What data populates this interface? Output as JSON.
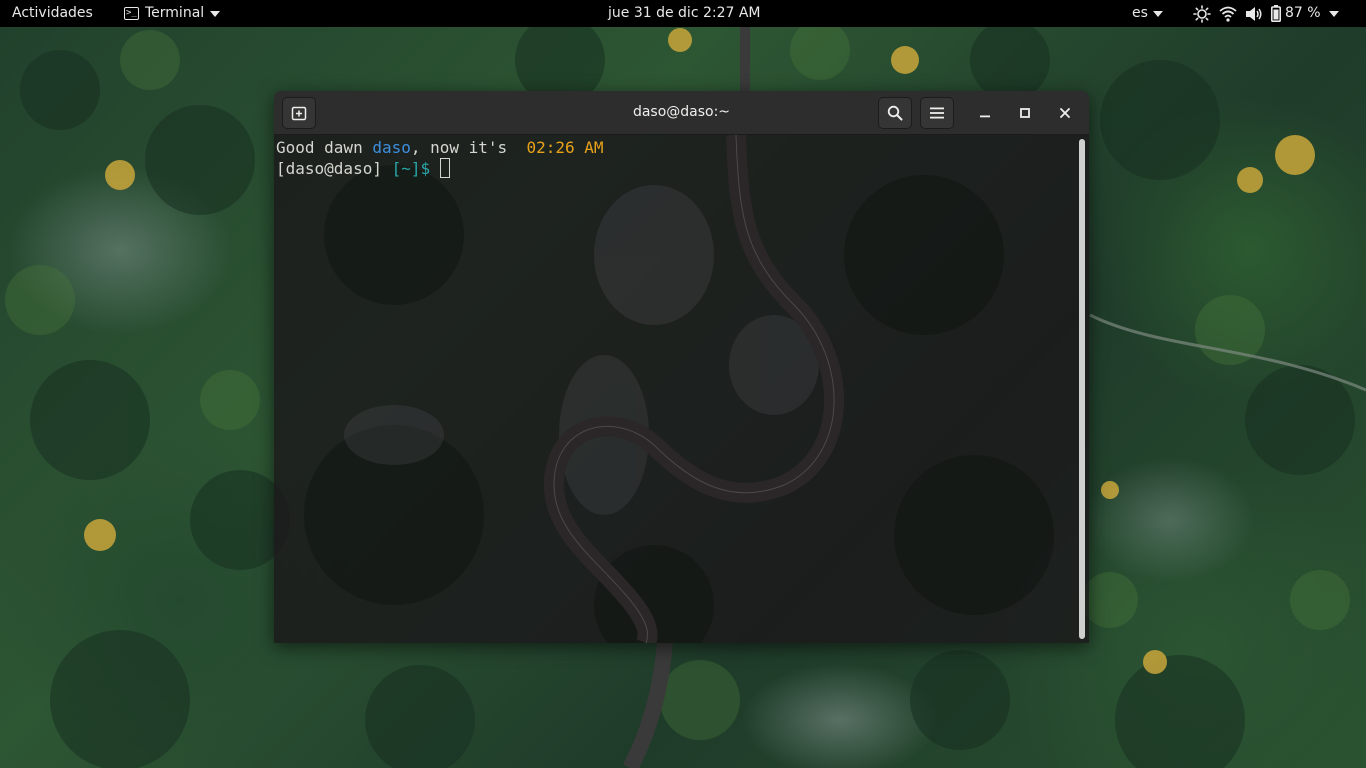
{
  "topbar": {
    "activities": "Actividades",
    "app_menu": {
      "label": "Terminal",
      "icon": "terminal-icon"
    },
    "clock": "jue 31 de dic  2:27 AM",
    "language": "es",
    "battery": "87 %",
    "status_icons": [
      "brightness-icon",
      "wifi-icon",
      "volume-icon",
      "battery-icon"
    ]
  },
  "terminal": {
    "title": "daso@daso:~",
    "buttons": [
      "new-tab-button",
      "search-button",
      "menu-button",
      "minimize-button",
      "maximize-button",
      "close-button"
    ],
    "lines": {
      "greeting_prefix": "Good dawn ",
      "greeting_user": "daso",
      "greeting_mid": ", now it's  ",
      "greeting_time": "02:26 AM",
      "prompt_user": "[daso@daso]",
      "prompt_dir": "[~]$"
    }
  },
  "colors": {
    "topbar_bg": "#000000",
    "headerbar_bg": "#2d2d2d",
    "terminal_bg": "#1a161a",
    "text": "#d3d7cf",
    "user_blue": "#3d8fe0",
    "time_yellow": "#e8a21a",
    "dir_cyan": "#2aa8a8"
  }
}
